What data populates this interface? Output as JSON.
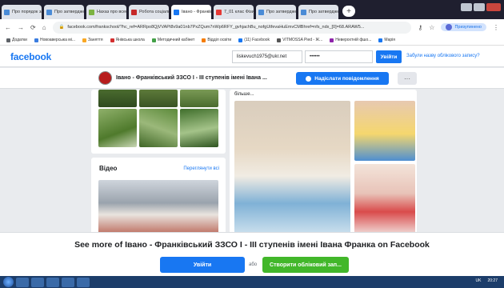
{
  "browser": {
    "tabs": [
      {
        "label": "Про порядок загс",
        "color": "#4a8bd6"
      },
      {
        "label": "Про затвердження",
        "color": "#4a8bd6"
      },
      {
        "label": "Нахаз про всесвітн",
        "color": "#7cb342"
      },
      {
        "label": "Робота соціально",
        "color": "#c62828"
      },
      {
        "label": "Івано - Франківськ",
        "color": "#1877f2",
        "active": true
      },
      {
        "label": "7_01 клас Фізика",
        "color": "#e53935"
      },
      {
        "label": "Про затвердження",
        "color": "#4a8bd6"
      },
      {
        "label": "Про затвердження",
        "color": "#4a8bd6"
      }
    ],
    "new_tab": "+",
    "url": "facebook.com/frankschool/?hc_ref=ARRpo8QjVVAPt8v9a01nb7PxZQum7nWp6RFY_gvhjachBu_nofgUtfevaHuEmvCMBhref=nfs_ndx_[0]=68.ARAW5...",
    "profile_label": "Призупинено",
    "bookmarks": [
      {
        "label": "Додатки",
        "color": "#5f6368"
      },
      {
        "label": "Новоаверсыка мі...",
        "color": "#3b7de0"
      },
      {
        "label": "Заняття",
        "color": "#f9a825"
      },
      {
        "label": "Янівська школа",
        "color": "#d32f2f"
      },
      {
        "label": "Методичний кабінет",
        "color": "#43a047"
      },
      {
        "label": "Відділ освіти",
        "color": "#f57c00"
      },
      {
        "label": "(11) Facebook",
        "color": "#1877f2"
      },
      {
        "label": "VITMOSSA Pied - Ж...",
        "color": "#555555"
      },
      {
        "label": "Неверохтній фшо...",
        "color": "#8e24aa"
      },
      {
        "label": "Марія",
        "color": "#1877f2"
      }
    ]
  },
  "fb": {
    "logo": "facebook",
    "email_value": "liskevuch1975@ukr.net",
    "password_value": "••••••",
    "login_label": "Увійти",
    "forgot_label": "Забули назву облікового запису?"
  },
  "page": {
    "name": "Івано - Франківський ЗЗСО І - ІІІ ступенів імені Івана ...",
    "message_label": "Надіслати повідомлення",
    "more_label": "···",
    "videos_title": "Відео",
    "see_all_label": "Переглянути всі",
    "more_text": "більше..."
  },
  "banner": {
    "title": "See more of Івано - Франківський ЗЗСО І - ІІІ ступенів імені Івана Франка on Facebook",
    "login_label": "Увійти",
    "or_label": "або",
    "create_label": "Створити обліковий зап..."
  },
  "taskbar": {
    "lang": "UK",
    "time": "20:27"
  }
}
